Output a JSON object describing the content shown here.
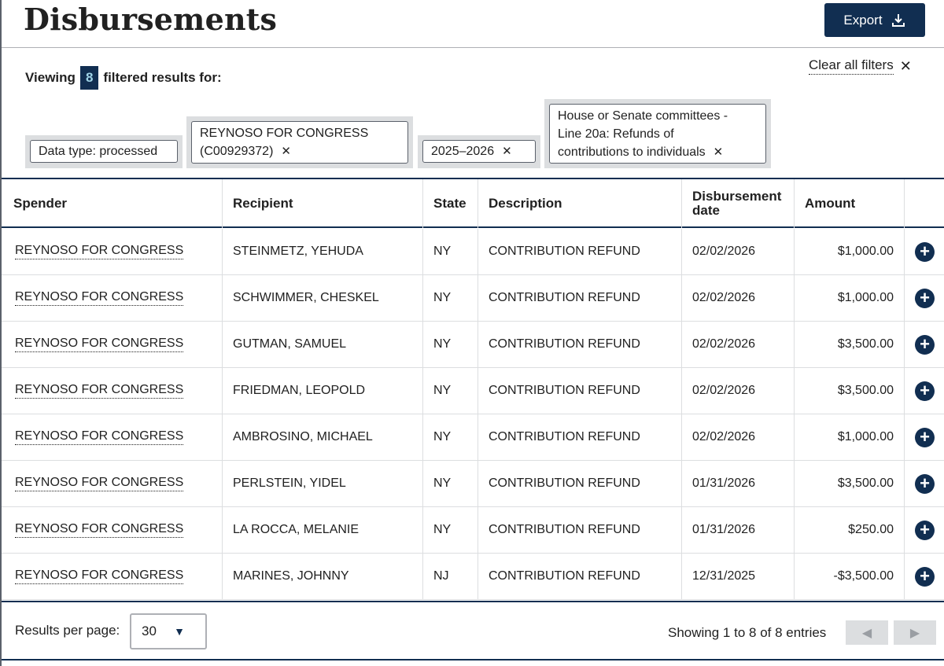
{
  "header": {
    "title": "Disbursements",
    "export_label": "Export"
  },
  "filters": {
    "viewing_prefix": "Viewing",
    "count": "8",
    "viewing_suffix": "filtered results for:",
    "clear_label": "Clear all filters",
    "tags": [
      {
        "label": "Data type: processed",
        "removable": false
      },
      {
        "label_line1": "REYNOSO FOR CONGRESS",
        "label_line2": "(C00929372)",
        "removable": true
      },
      {
        "label": "2025–2026",
        "removable": true
      },
      {
        "label_line1": "House or Senate committees -",
        "label_line2": "Line 20a: Refunds of",
        "label_line3": "contributions to individuals",
        "removable": true
      }
    ]
  },
  "table": {
    "columns": [
      "Spender",
      "Recipient",
      "State",
      "Description",
      "Disbursement date",
      "Amount"
    ],
    "rows": [
      {
        "spender": "REYNOSO FOR CONGRESS",
        "recipient": "STEINMETZ, YEHUDA",
        "state": "NY",
        "description": "CONTRIBUTION REFUND",
        "date": "02/02/2026",
        "amount": "$1,000.00"
      },
      {
        "spender": "REYNOSO FOR CONGRESS",
        "recipient": "SCHWIMMER, CHESKEL",
        "state": "NY",
        "description": "CONTRIBUTION REFUND",
        "date": "02/02/2026",
        "amount": "$1,000.00"
      },
      {
        "spender": "REYNOSO FOR CONGRESS",
        "recipient": "GUTMAN, SAMUEL",
        "state": "NY",
        "description": "CONTRIBUTION REFUND",
        "date": "02/02/2026",
        "amount": "$3,500.00"
      },
      {
        "spender": "REYNOSO FOR CONGRESS",
        "recipient": "FRIEDMAN, LEOPOLD",
        "state": "NY",
        "description": "CONTRIBUTION REFUND",
        "date": "02/02/2026",
        "amount": "$3,500.00"
      },
      {
        "spender": "REYNOSO FOR CONGRESS",
        "recipient": "AMBROSINO, MICHAEL",
        "state": "NY",
        "description": "CONTRIBUTION REFUND",
        "date": "02/02/2026",
        "amount": "$1,000.00"
      },
      {
        "spender": "REYNOSO FOR CONGRESS",
        "recipient": "PERLSTEIN, YIDEL",
        "state": "NY",
        "description": "CONTRIBUTION REFUND",
        "date": "01/31/2026",
        "amount": "$3,500.00"
      },
      {
        "spender": "REYNOSO FOR CONGRESS",
        "recipient": "LA ROCCA, MELANIE",
        "state": "NY",
        "description": "CONTRIBUTION REFUND",
        "date": "01/31/2026",
        "amount": "$250.00"
      },
      {
        "spender": "REYNOSO FOR CONGRESS",
        "recipient": "MARINES, JOHNNY",
        "state": "NJ",
        "description": "CONTRIBUTION REFUND",
        "date": "12/31/2025",
        "amount": "-$3,500.00"
      }
    ]
  },
  "footer": {
    "rpp_label": "Results per page:",
    "rpp_value": "30",
    "showing": "Showing 1 to 8 of 8 entries"
  },
  "icons": {
    "export": "download-icon",
    "row_action": "plus-circle-icon",
    "prev": "triangle-left-icon",
    "next": "triangle-right-icon"
  },
  "colors": {
    "primary": "#112e51",
    "badge_text": "#9fd3e6",
    "tag_bg": "#dcdee0"
  }
}
